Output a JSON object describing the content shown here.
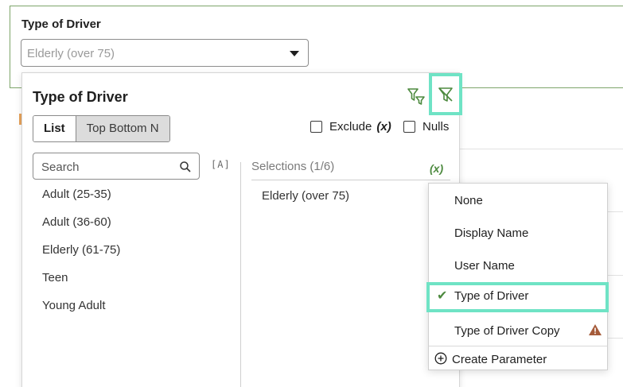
{
  "filter_bar": {
    "title": "Type of Driver",
    "selected_value": "Elderly (over 75)"
  },
  "popup": {
    "title": "Type of Driver",
    "tabs": [
      {
        "label": "List",
        "active": true
      },
      {
        "label": "Top Bottom N",
        "active": false
      }
    ],
    "exclude_label": "Exclude",
    "exclude_fx": "(x)",
    "nulls_label": "Nulls",
    "search_placeholder": "Search",
    "case_toggle": "[A]",
    "values": [
      "Adult (25-35)",
      "Adult (36-60)",
      "Elderly (61-75)",
      "Teen",
      "Young Adult"
    ],
    "selections_header": "Selections (1/6)",
    "selections_fx": "(x)",
    "selections": [
      "Elderly (over 75)"
    ],
    "icons": {
      "apply_filter": "filter-settings-icon",
      "clear_filter": "filter-clear-icon"
    }
  },
  "binding_menu": {
    "items": [
      {
        "label": "None",
        "selected": false
      },
      {
        "label": "Display Name",
        "selected": false
      },
      {
        "label": "User Name",
        "selected": false
      },
      {
        "label": "Type of Driver",
        "selected": true
      },
      {
        "label": "Type of Driver Copy",
        "selected": false,
        "warning": true
      }
    ],
    "create_label": "Create Parameter"
  },
  "colors": {
    "accent_green": "#4d8a3f",
    "highlight": "#6fe3c5",
    "warning": "#a55b3a"
  }
}
